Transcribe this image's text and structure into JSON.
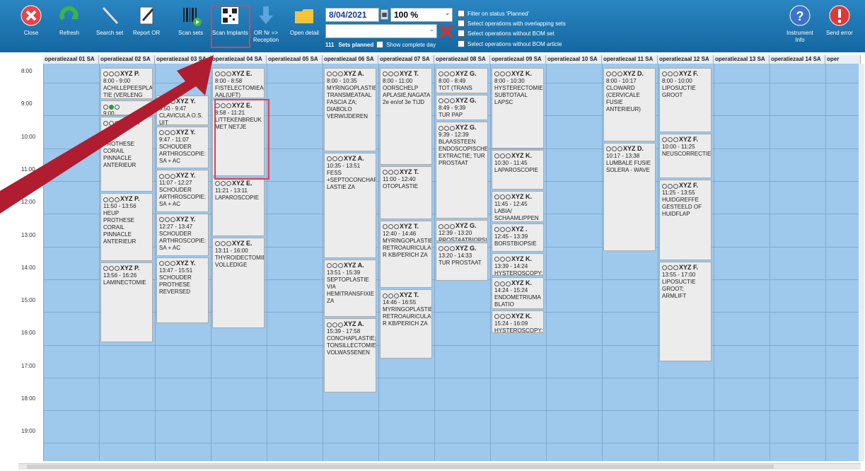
{
  "toolbar": {
    "close": "Close",
    "refresh": "Refresh",
    "search_set": "Search set",
    "report_or": "Report OR",
    "scan_sets": "Scan sets",
    "scan_implants": "Scan Implants",
    "or_nr_reception": "OR Nr =>\nReception",
    "open_detail": "Open detail",
    "instrument_info": "Instrument\nInfo",
    "send_error": "Send error"
  },
  "date": "8/04/2021",
  "zoom": "100 %",
  "filters": [
    "Filter on status 'Planned'",
    "Select operations with overlapping sets",
    "Select operations without BOM set",
    "Select operations without BOM article"
  ],
  "sets_planned_count": "111",
  "sets_planned_label": "Sets planned",
  "show_complete_day": "Show complete day",
  "hours": [
    "8:00",
    "9:00",
    "10:00",
    "11:00",
    "12:00",
    "13:00",
    "14:00",
    "15:00",
    "16:00",
    "17:00",
    "18:00",
    "19:00"
  ],
  "rooms": [
    "operatiezaal 01 SA",
    "operatiezaal 02 SA",
    "operatiezaal 03 SA",
    "operatiezaal 04 SA",
    "operatiezaal 05 SA",
    "operatiezaal 06 SA",
    "operatiezaal 07 SA",
    "operatiezaal 08 SA",
    "operatiezaal 09 SA",
    "operatiezaal 10 SA",
    "operatiezaal 11 SA",
    "operatiezaal 12 SA",
    "operatiezaal 13 SA",
    "operatiezaal 14 SA",
    "oper"
  ],
  "appointments": [
    {
      "room": 1,
      "name": "XYZ P.",
      "time": "8:00 - 9:00",
      "desc": "ACHILLEPEESPLAS TIE (VERLENG"
    },
    {
      "room": 1,
      "name": "",
      "time": "9:00",
      "desc": ""
    },
    {
      "room": 1,
      "name": "XYZ P.",
      "time": "- 11:50",
      "desc": "HEUP PROTHESE CORAIL PINNACLE ANTERIEUR"
    },
    {
      "room": 1,
      "name": "XYZ P.",
      "time": "11:50 - 13:56",
      "desc": "HEUP PROTHESE CORAIL PINNACLE ANTERIEUR"
    },
    {
      "room": 1,
      "name": "XYZ P.",
      "time": "13:56 - 16:26",
      "desc": "LAMINECTOMIE"
    },
    {
      "room": 2,
      "name": "",
      "time": "8:50",
      "desc": ""
    },
    {
      "room": 2,
      "name": "XYZ Y.",
      "time": "8:50 - 9:47",
      "desc": "CLAVICULA O.S. UIT"
    },
    {
      "room": 2,
      "name": "XYZ Y.",
      "time": "9:47 - 11:07",
      "desc": "SCHOUDER ARTHROSCOPIE: SA + AC"
    },
    {
      "room": 2,
      "name": "XYZ Y.",
      "time": "11:07 - 12:27",
      "desc": "SCHOUDER ARTHROSCOPIE: SA + AC"
    },
    {
      "room": 2,
      "name": "XYZ Y.",
      "time": "12:27 - 13:47",
      "desc": "SCHOUDER ARTHROSCOPIE: SA + AC"
    },
    {
      "room": 2,
      "name": "XYZ Y.",
      "time": "13:47 - 15:51",
      "desc": "SCHOUDER PROTHESE REVERSED"
    },
    {
      "room": 3,
      "name": "XYZ E.",
      "time": "8:00 - 8:58",
      "desc": "FISTELECTOMIEAN AAL(UFT)"
    },
    {
      "room": 3,
      "name": "XYZ E.",
      "time": "8:58 - 11:21",
      "desc": "LITTEKENBREUK MET NETJE"
    },
    {
      "room": 3,
      "name": "XYZ E.",
      "time": "11:21 - 13:11",
      "desc": "LAPAROSCOPIE"
    },
    {
      "room": 3,
      "name": "XYZ E.",
      "time": "13:11 - 16:00",
      "desc": "THYROIDECTOMIE VOLLEDIGE"
    },
    {
      "room": 5,
      "name": "XYZ A.",
      "time": "8:00 - 10:35",
      "desc": "MYRINGOPLASTIE TRANSMEATAAL FASCIA ZA; DIABOLO VERWIJDEREN"
    },
    {
      "room": 5,
      "name": "XYZ A.",
      "time": "10:35 - 13:51",
      "desc": "FESS +SEPTOCONCHAP LASTIE ZA"
    },
    {
      "room": 5,
      "name": "XYZ A.",
      "time": "13:51 - 15:39",
      "desc": "SEPTOPLASTIE VIA HEMITRANSFIXIE ZA"
    },
    {
      "room": 5,
      "name": "XYZ A.",
      "time": "15:39 - 17:58",
      "desc": "CONCHAPLASTIE; TONSILLECTOMIE VOLWASSENEN"
    },
    {
      "room": 6,
      "name": "XYZ T.",
      "time": "8:00 - 11:00",
      "desc": "OORSCHELP APLASIE,NAGATA 2e en/of 3e TIJD"
    },
    {
      "room": 6,
      "name": "XYZ T.",
      "time": "11:00 - 12:40",
      "desc": "OTOPLASTIE"
    },
    {
      "room": 6,
      "name": "XYZ T.",
      "time": "12:40 - 14:46",
      "desc": "MYRINGOPLASTIE RETROAURICULAI R KB/PERICH ZA"
    },
    {
      "room": 6,
      "name": "XYZ T.",
      "time": "14:46 - 16:55",
      "desc": "MYRINGOPLASTIE RETROAURICULAI R KB/PERICH ZA"
    },
    {
      "room": 7,
      "name": "XYZ G.",
      "time": "8:00 - 8:49",
      "desc": "TOT (TRANS"
    },
    {
      "room": 7,
      "name": "XYZ G.",
      "time": "8:49 - 9:39",
      "desc": "TUR PAP"
    },
    {
      "room": 7,
      "name": "XYZ G.",
      "time": "9:39 - 12:39",
      "desc": "BLAASSTEEN ENDOSCOPISCHE EXTRACTIE; TUR PROSTAAT"
    },
    {
      "room": 7,
      "name": "XYZ G.",
      "time": "12:39 - 13:20",
      "desc": "PROSTAATBIOPSIE"
    },
    {
      "room": 7,
      "name": "XYZ G.",
      "time": "13:20 - 14:33",
      "desc": "TUR PROSTAAT"
    },
    {
      "room": 8,
      "name": "XYZ K.",
      "time": "8:00 - 10:30",
      "desc": "HYSTERECTOMIE SUBTOTAAL LAPSC"
    },
    {
      "room": 8,
      "name": "XYZ K.",
      "time": "10:30 - 11:45",
      "desc": "LAPAROSCOPIE"
    },
    {
      "room": 8,
      "name": "XYZ K.",
      "time": "11:45 - 12:45",
      "desc": "LABIA/ SCHAAMLIPPEN"
    },
    {
      "room": 8,
      "name": "XYZ .",
      "time": "12:45 - 13:39",
      "desc": "BORSTBIOPSIE"
    },
    {
      "room": 8,
      "name": "XYZ K.",
      "time": "13:39 - 14:24",
      "desc": "HYSTEROSCOPY:"
    },
    {
      "room": 8,
      "name": "XYZ K.",
      "time": "14:24 - 15:24",
      "desc": "ENDOMETRIUMA BLATIO"
    },
    {
      "room": 8,
      "name": "XYZ K.",
      "time": "15:24 - 16:09",
      "desc": "HYSTEROSCOPY:"
    },
    {
      "room": 10,
      "name": "XYZ D.",
      "time": "8:00 - 10:17",
      "desc": "CLOWARD (CERVICALE FUSIE ANTERIEUR)"
    },
    {
      "room": 10,
      "name": "XYZ D.",
      "time": "10:17 - 13:38",
      "desc": "LUMBALE FUSIE SOLERA - WAVE"
    },
    {
      "room": 11,
      "name": "XYZ F.",
      "time": "8:00 - 10:00",
      "desc": "LIPOSUCTIE GROOT"
    },
    {
      "room": 11,
      "name": "XYZ F.",
      "time": "10:00 - 11:25",
      "desc": "NEUSCORRECTIE"
    },
    {
      "room": 11,
      "name": "XYZ F.",
      "time": "11:25 - 13:55",
      "desc": "HUIDGREFFE GESTEELD OF HUIDFLAP"
    },
    {
      "room": 11,
      "name": "XYZ F.",
      "time": "13:55 - 17:00",
      "desc": "LIPOSUCTIE GROOT; ARMLIFT"
    }
  ],
  "colors": {
    "toolbar": "#1e78b4",
    "grid_bg": "#9ec8ec",
    "highlight": "#e04050",
    "arrow": "#b01c30"
  }
}
